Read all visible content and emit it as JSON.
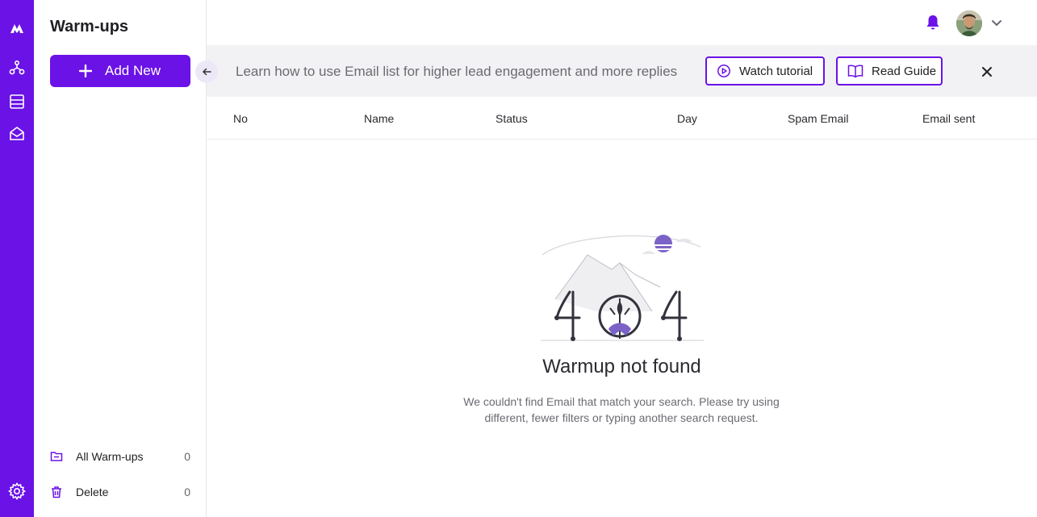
{
  "sidebar": {
    "title": "Warm-ups",
    "add_button": "Add New",
    "items": [
      {
        "label": "All Warm-ups",
        "count": "0"
      },
      {
        "label": "Delete",
        "count": "0"
      }
    ]
  },
  "banner": {
    "text": "Learn how to use Email list for higher lead engagement and more replies",
    "watch_label": "Watch tutorial",
    "read_label": "Read Guide"
  },
  "table": {
    "columns": [
      "No",
      "Name",
      "Status",
      "Day",
      "Spam Email",
      "Email sent"
    ]
  },
  "empty_state": {
    "title": "Warmup not found",
    "description": "We couldn't find Email that match your search. Please try using different, fewer filters or typing another search request."
  },
  "colors": {
    "accent": "#6b12e6",
    "banner_bg": "#f2f2f4",
    "bell": "#6b12e6"
  },
  "icons": [
    "logo-icon",
    "workflow-icon",
    "list-icon",
    "inbox-icon",
    "settings-icon",
    "plus-icon",
    "arrow-left-icon",
    "folder-icon",
    "trash-icon",
    "bell-icon",
    "chevron-down-icon",
    "play-circle-icon",
    "book-icon",
    "close-icon"
  ]
}
